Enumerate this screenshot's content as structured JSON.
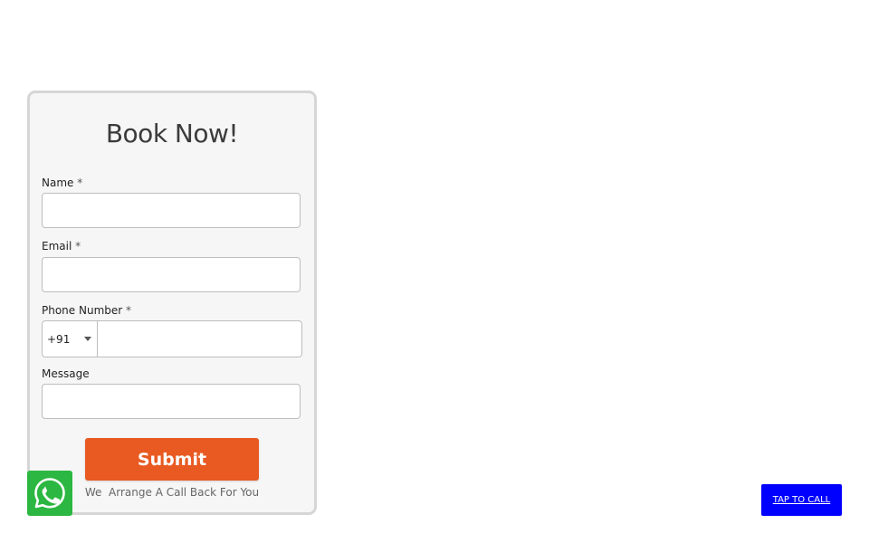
{
  "form": {
    "title": "Book Now!",
    "fields": {
      "name": {
        "label": "Name",
        "required_mark": "*",
        "value": "",
        "placeholder": ""
      },
      "email": {
        "label": "Email",
        "required_mark": "*",
        "value": "",
        "placeholder": ""
      },
      "phone": {
        "label": "Phone Number",
        "required_mark": "*",
        "country_code": "+91",
        "value": "",
        "placeholder": ""
      },
      "message": {
        "label": "Message",
        "value": "",
        "placeholder": ""
      }
    },
    "submit_label": "Submit",
    "note": "We  Arrange A Call Back For You"
  },
  "floating": {
    "whatsapp_icon": "whatsapp-icon",
    "tap_to_call_label": "TAP TO CALL"
  },
  "colors": {
    "submit": "#e85a22",
    "whatsapp": "#2bb741",
    "tap_to_call": "#0000ff",
    "card_bg": "#f6f6f6",
    "card_border": "#d6d6d6"
  }
}
